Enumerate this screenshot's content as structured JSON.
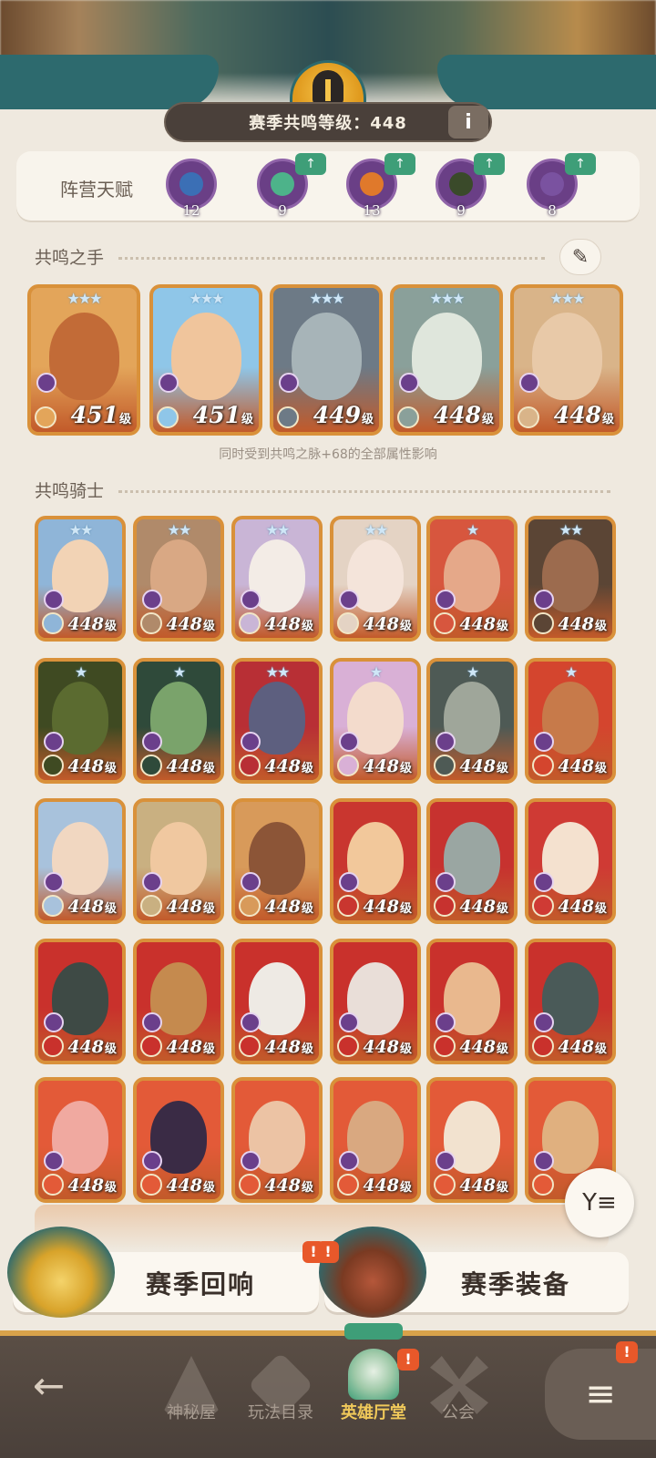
{
  "header": {
    "resonance_label": "赛季共鸣等级：448",
    "info_icon": "i"
  },
  "faction_talent": {
    "title": "阵营天赋",
    "items": [
      {
        "value": "12",
        "color": "#3b6fb5",
        "upgradable": false
      },
      {
        "value": "9",
        "color": "#4db38a",
        "upgradable": true
      },
      {
        "value": "13",
        "color": "#e0792b",
        "upgradable": true
      },
      {
        "value": "9",
        "color": "#3a4a2a",
        "upgradable": true
      },
      {
        "value": "8",
        "color": "#7a52a0",
        "upgradable": true
      }
    ],
    "upgrade_icon": "↑"
  },
  "hands": {
    "title": "共鸣之手",
    "quill_icon": "✎",
    "cards": [
      {
        "level": "451",
        "unit": "级",
        "skin": "#c26b37",
        "bg": "#e3a55a"
      },
      {
        "level": "451",
        "unit": "级",
        "skin": "#f0c59c",
        "bg": "#8fc6e8"
      },
      {
        "level": "449",
        "unit": "级",
        "skin": "#a7b4b8",
        "bg": "#6d7a86"
      },
      {
        "level": "448",
        "unit": "级",
        "skin": "#dfe6dc",
        "bg": "#8aa09a"
      },
      {
        "level": "448",
        "unit": "级",
        "skin": "#e8c9a8",
        "bg": "#d9b489"
      }
    ],
    "note": "同时受到共鸣之脉+68的全部属性影响"
  },
  "knights": {
    "title": "共鸣骑士",
    "rows": [
      [
        {
          "level": "448",
          "unit": "级",
          "skin": "#f2d3b5",
          "bg": "#8fb5d8"
        },
        {
          "level": "448",
          "unit": "级",
          "skin": "#d9a884",
          "bg": "#b08a6a"
        },
        {
          "level": "448",
          "unit": "级",
          "skin": "#f3ece6",
          "bg": "#c9b5d6"
        },
        {
          "level": "448",
          "unit": "级",
          "skin": "#f4e4da",
          "bg": "#e4d3c4"
        },
        {
          "level": "448",
          "unit": "级",
          "skin": "#e5a889",
          "bg": "#d7563e"
        },
        {
          "level": "448",
          "unit": "级",
          "skin": "#9c6b4e",
          "bg": "#5b4535"
        }
      ],
      [
        {
          "level": "448",
          "unit": "级",
          "skin": "#5b6b30",
          "bg": "#3f4a22"
        },
        {
          "level": "448",
          "unit": "级",
          "skin": "#7aa36b",
          "bg": "#2f4a3a"
        },
        {
          "level": "448",
          "unit": "级",
          "skin": "#5d5f7f",
          "bg": "#b82f35"
        },
        {
          "level": "448",
          "unit": "级",
          "skin": "#f3dbcc",
          "bg": "#d9b0d6"
        },
        {
          "level": "448",
          "unit": "级",
          "skin": "#9fa69a",
          "bg": "#4e5a55"
        },
        {
          "level": "448",
          "unit": "级",
          "skin": "#c77a4a",
          "bg": "#d4452e"
        }
      ],
      [
        {
          "level": "448",
          "unit": "级",
          "skin": "#f1d7c1",
          "bg": "#a8c2dc"
        },
        {
          "level": "448",
          "unit": "级",
          "skin": "#f0c8a0",
          "bg": "#c9b081"
        },
        {
          "level": "448",
          "unit": "级",
          "skin": "#8c5537",
          "bg": "#d89a5a"
        },
        {
          "level": "448",
          "unit": "级",
          "skin": "#f2c89b",
          "bg": "#c9362f"
        },
        {
          "level": "448",
          "unit": "级",
          "skin": "#9aa6a2",
          "bg": "#c7322f"
        },
        {
          "level": "448",
          "unit": "级",
          "skin": "#f4e1cf",
          "bg": "#cf3a34"
        }
      ],
      [
        {
          "level": "448",
          "unit": "级",
          "skin": "#3e4a45",
          "bg": "#c9312c"
        },
        {
          "level": "448",
          "unit": "级",
          "skin": "#c58a4e",
          "bg": "#c9312c"
        },
        {
          "level": "448",
          "unit": "级",
          "skin": "#eeeae4",
          "bg": "#c9312c"
        },
        {
          "level": "448",
          "unit": "级",
          "skin": "#e9ded8",
          "bg": "#c9312c"
        },
        {
          "level": "448",
          "unit": "级",
          "skin": "#e9b88e",
          "bg": "#c9312c"
        },
        {
          "level": "448",
          "unit": "级",
          "skin": "#4a5a58",
          "bg": "#c9312c"
        }
      ],
      [
        {
          "level": "448",
          "unit": "级",
          "skin": "#f0a9a0",
          "bg": "#e35a38"
        },
        {
          "level": "448",
          "unit": "级",
          "skin": "#3a2b45",
          "bg": "#e35a38"
        },
        {
          "level": "448",
          "unit": "级",
          "skin": "#ecc3a4",
          "bg": "#e35a38"
        },
        {
          "level": "448",
          "unit": "级",
          "skin": "#d9a880",
          "bg": "#e35a38"
        },
        {
          "level": "448",
          "unit": "级",
          "skin": "#f2e2cf",
          "bg": "#e35a38"
        },
        {
          "level": "4",
          "unit": "",
          "skin": "#e0b07f",
          "bg": "#e35a38"
        }
      ]
    ]
  },
  "banners": {
    "season_echo": "赛季回响",
    "season_gear": "赛季装备",
    "alert": "!"
  },
  "filter_icon": "Y≡",
  "nav": {
    "back_icon": "←",
    "items": [
      {
        "label": "神秘屋",
        "active": false
      },
      {
        "label": "玩法目录",
        "active": false
      },
      {
        "label": "英雄厅堂",
        "active": true
      },
      {
        "label": "公会",
        "active": false
      }
    ],
    "menu_icon": "≡",
    "alert": "!"
  }
}
